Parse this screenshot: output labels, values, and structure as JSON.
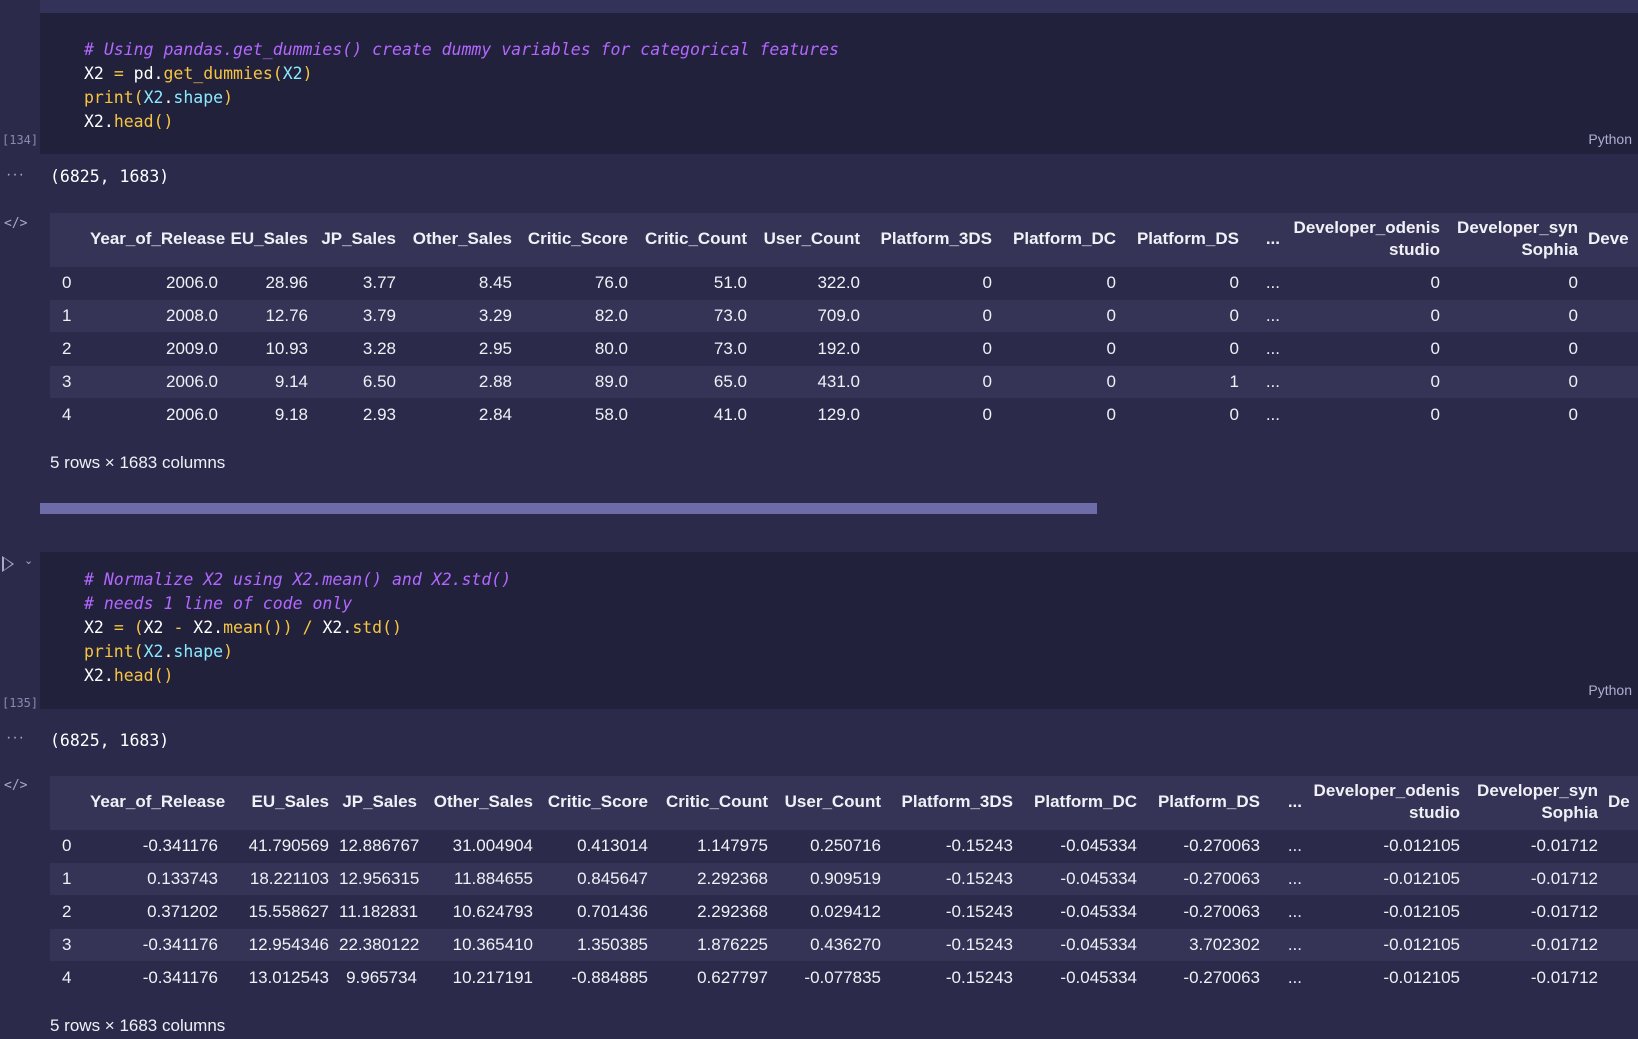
{
  "cell1": {
    "exec_count": "[134]",
    "language": "Python",
    "code": [
      [
        {
          "t": "# Using pandas.get_dummies() create dummy variables for categorical features",
          "c": "cm"
        }
      ],
      [
        {
          "t": "X2 ",
          "c": ""
        },
        {
          "t": "=",
          "c": "op"
        },
        {
          "t": " pd.",
          "c": ""
        },
        {
          "t": "get_dummies",
          "c": "fn"
        },
        {
          "t": "(",
          "c": "op"
        },
        {
          "t": "X2",
          "c": "vr"
        },
        {
          "t": ")",
          "c": "op"
        }
      ],
      [
        {
          "t": "print",
          "c": "fn"
        },
        {
          "t": "(",
          "c": "op"
        },
        {
          "t": "X2",
          "c": "vr"
        },
        {
          "t": ".",
          "c": ""
        },
        {
          "t": "shape",
          "c": "vr"
        },
        {
          "t": ")",
          "c": "op"
        }
      ],
      [
        {
          "t": "X2.",
          "c": ""
        },
        {
          "t": "head",
          "c": "fn"
        },
        {
          "t": "()",
          "c": "op"
        }
      ]
    ],
    "shape_output": "(6825, 1683)",
    "table": {
      "headers": [
        "",
        "Year_of_Release",
        "EU_Sales",
        "JP_Sales",
        "Other_Sales",
        "Critic_Score",
        "Critic_Count",
        "User_Count",
        "Platform_3DS",
        "Platform_DC",
        "Platform_DS",
        "...",
        "Developer_odenis\nstudio",
        "Developer_syn\nSophia",
        "Deve"
      ],
      "rows": [
        [
          "0",
          "2006.0",
          "28.96",
          "3.77",
          "8.45",
          "76.0",
          "51.0",
          "322.0",
          "0",
          "0",
          "0",
          "...",
          "0",
          "0",
          ""
        ],
        [
          "1",
          "2008.0",
          "12.76",
          "3.79",
          "3.29",
          "82.0",
          "73.0",
          "709.0",
          "0",
          "0",
          "0",
          "...",
          "0",
          "0",
          ""
        ],
        [
          "2",
          "2009.0",
          "10.93",
          "3.28",
          "2.95",
          "80.0",
          "73.0",
          "192.0",
          "0",
          "0",
          "0",
          "...",
          "0",
          "0",
          ""
        ],
        [
          "3",
          "2006.0",
          "9.14",
          "6.50",
          "2.88",
          "89.0",
          "65.0",
          "431.0",
          "0",
          "0",
          "1",
          "...",
          "0",
          "0",
          ""
        ],
        [
          "4",
          "2006.0",
          "9.18",
          "2.93",
          "2.84",
          "58.0",
          "41.0",
          "129.0",
          "0",
          "0",
          "0",
          "...",
          "0",
          "0",
          ""
        ]
      ],
      "footer": "5 rows × 1683 columns"
    }
  },
  "cell2": {
    "exec_count": "[135]",
    "language": "Python",
    "code": [
      [
        {
          "t": "# Normalize X2 using X2.mean() and X2.std()",
          "c": "cm"
        }
      ],
      [
        {
          "t": "# needs 1 line of code only",
          "c": "cm"
        }
      ],
      [
        {
          "t": "X2 ",
          "c": ""
        },
        {
          "t": "=",
          "c": "op"
        },
        {
          "t": " ",
          "c": ""
        },
        {
          "t": "(",
          "c": "op"
        },
        {
          "t": "X2 ",
          "c": ""
        },
        {
          "t": "-",
          "c": "op"
        },
        {
          "t": " X2.",
          "c": ""
        },
        {
          "t": "mean",
          "c": "fn"
        },
        {
          "t": "())",
          "c": "op"
        },
        {
          "t": " ",
          "c": ""
        },
        {
          "t": "/",
          "c": "op"
        },
        {
          "t": " X2.",
          "c": ""
        },
        {
          "t": "std",
          "c": "fn"
        },
        {
          "t": "()",
          "c": "op"
        }
      ],
      [
        {
          "t": "print",
          "c": "fn"
        },
        {
          "t": "(",
          "c": "op"
        },
        {
          "t": "X2",
          "c": "vr"
        },
        {
          "t": ".",
          "c": ""
        },
        {
          "t": "shape",
          "c": "vr"
        },
        {
          "t": ")",
          "c": "op"
        }
      ],
      [
        {
          "t": "X2.",
          "c": ""
        },
        {
          "t": "head",
          "c": "fn"
        },
        {
          "t": "()",
          "c": "op"
        }
      ]
    ],
    "shape_output": "(6825, 1683)",
    "table": {
      "headers": [
        "",
        "Year_of_Release",
        "EU_Sales",
        "JP_Sales",
        "Other_Sales",
        "Critic_Score",
        "Critic_Count",
        "User_Count",
        "Platform_3DS",
        "Platform_DC",
        "Platform_DS",
        "...",
        "Developer_odenis\nstudio",
        "Developer_syn\nSophia",
        "De"
      ],
      "rows": [
        [
          "0",
          "-0.341176",
          "41.790569",
          "12.886767",
          "31.004904",
          "0.413014",
          "1.147975",
          "0.250716",
          "-0.15243",
          "-0.045334",
          "-0.270063",
          "...",
          "-0.012105",
          "-0.01712",
          ""
        ],
        [
          "1",
          "0.133743",
          "18.221103",
          "12.956315",
          "11.884655",
          "0.845647",
          "2.292368",
          "0.909519",
          "-0.15243",
          "-0.045334",
          "-0.270063",
          "...",
          "-0.012105",
          "-0.01712",
          ""
        ],
        [
          "2",
          "0.371202",
          "15.558627",
          "11.182831",
          "10.624793",
          "0.701436",
          "2.292368",
          "0.029412",
          "-0.15243",
          "-0.045334",
          "-0.270063",
          "...",
          "-0.012105",
          "-0.01712",
          ""
        ],
        [
          "3",
          "-0.341176",
          "12.954346",
          "22.380122",
          "10.365410",
          "1.350385",
          "1.876225",
          "0.436270",
          "-0.15243",
          "-0.045334",
          "3.702302",
          "...",
          "-0.012105",
          "-0.01712",
          ""
        ],
        [
          "4",
          "-0.341176",
          "13.012543",
          "9.965734",
          "10.217191",
          "-0.884885",
          "0.627797",
          "-0.077835",
          "-0.15243",
          "-0.045334",
          "-0.270063",
          "...",
          "-0.012105",
          "-0.01712",
          ""
        ]
      ],
      "footer": "5 rows × 1683 columns"
    }
  }
}
